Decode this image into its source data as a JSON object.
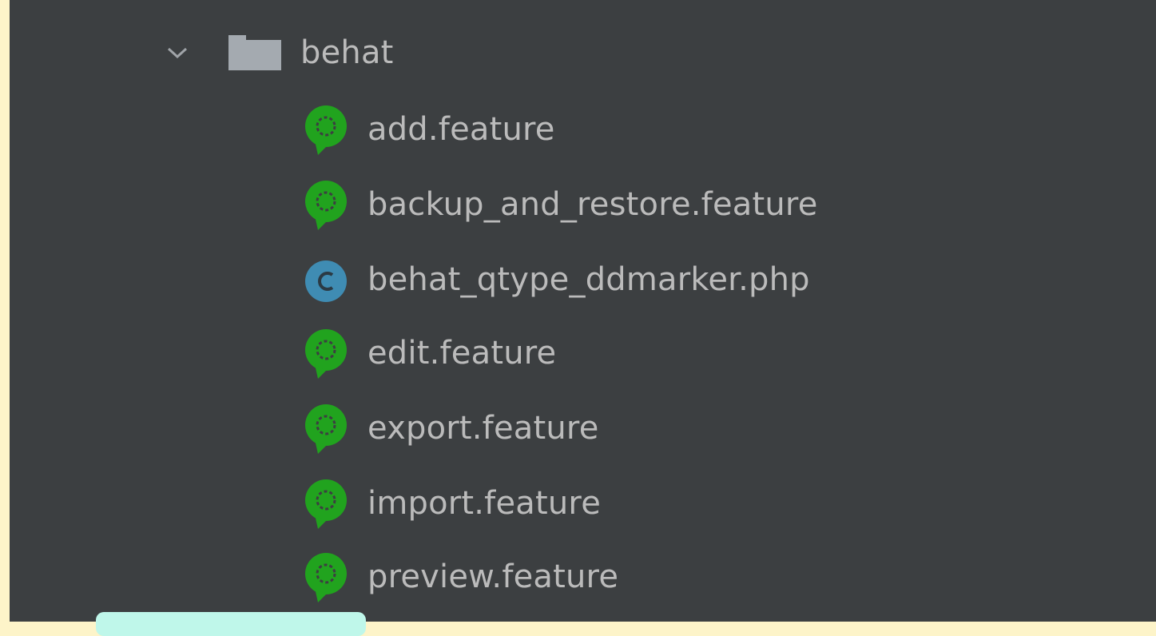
{
  "tree": {
    "folder": {
      "name": "behat",
      "icon": "folder-icon",
      "expanded": true
    },
    "files": [
      {
        "name": "add.feature",
        "icon": "cucumber-feature-icon"
      },
      {
        "name": "backup_and_restore.feature",
        "icon": "cucumber-feature-icon"
      },
      {
        "name": "behat_qtype_ddmarker.php",
        "icon": "php-class-icon"
      },
      {
        "name": "edit.feature",
        "icon": "cucumber-feature-icon"
      },
      {
        "name": "export.feature",
        "icon": "cucumber-feature-icon"
      },
      {
        "name": "import.feature",
        "icon": "cucumber-feature-icon"
      },
      {
        "name": "preview.feature",
        "icon": "cucumber-feature-icon"
      }
    ]
  },
  "colors": {
    "panel_background": "#3c3f41",
    "text": "#bbbbbb",
    "feature_icon": "#21a31e",
    "class_icon": "#3f8cb3",
    "folder_icon": "#a4aab0",
    "left_strip": "#fdf4c9",
    "bottom_tab": "#bff7ea"
  }
}
